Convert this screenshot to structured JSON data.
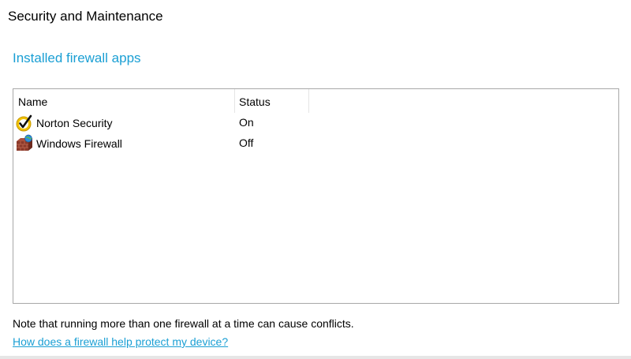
{
  "window": {
    "title": "Security and Maintenance"
  },
  "section": {
    "heading": "Installed firewall apps"
  },
  "firewall_list": {
    "columns": {
      "name": "Name",
      "status": "Status"
    },
    "rows": [
      {
        "name": "Norton Security",
        "status": "On",
        "icon": "norton-check-icon"
      },
      {
        "name": "Windows Firewall",
        "status": "Off",
        "icon": "windows-firewall-icon"
      }
    ]
  },
  "note": "Note that running more than one firewall at a time can cause conflicts.",
  "help_link": "How does a firewall help protect my device?",
  "colors": {
    "accent": "#1a9fd4",
    "norton_yellow": "#f2c200",
    "firewall_brick": "#8b3a2b"
  }
}
